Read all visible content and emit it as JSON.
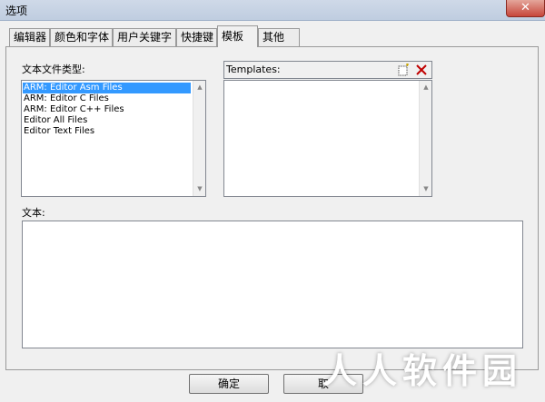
{
  "window": {
    "title": "选项",
    "close_label": "✕"
  },
  "tabs": [
    {
      "label": "编辑器"
    },
    {
      "label": "颜色和字体"
    },
    {
      "label": "用户关键字"
    },
    {
      "label": "快捷键"
    },
    {
      "label": "模板",
      "active": true
    },
    {
      "label": "其他"
    }
  ],
  "file_types": {
    "label": "文本文件类型:",
    "items": [
      {
        "label": "ARM: Editor Asm Files",
        "selected": true
      },
      {
        "label": "ARM: Editor C Files"
      },
      {
        "label": "ARM: Editor C++ Files"
      },
      {
        "label": "Editor All Files"
      },
      {
        "label": "Editor Text Files"
      }
    ]
  },
  "templates": {
    "label": "Templates:",
    "new_icon": "new-template-icon",
    "delete_icon": "delete-template-icon"
  },
  "text_area": {
    "label": "文本:",
    "value": ""
  },
  "buttons": {
    "ok": "确定",
    "cancel": "取"
  },
  "watermark": "人人软件园",
  "colors": {
    "selection": "#3399ff",
    "close": "#c7463a",
    "delete_icon": "#c00000"
  }
}
